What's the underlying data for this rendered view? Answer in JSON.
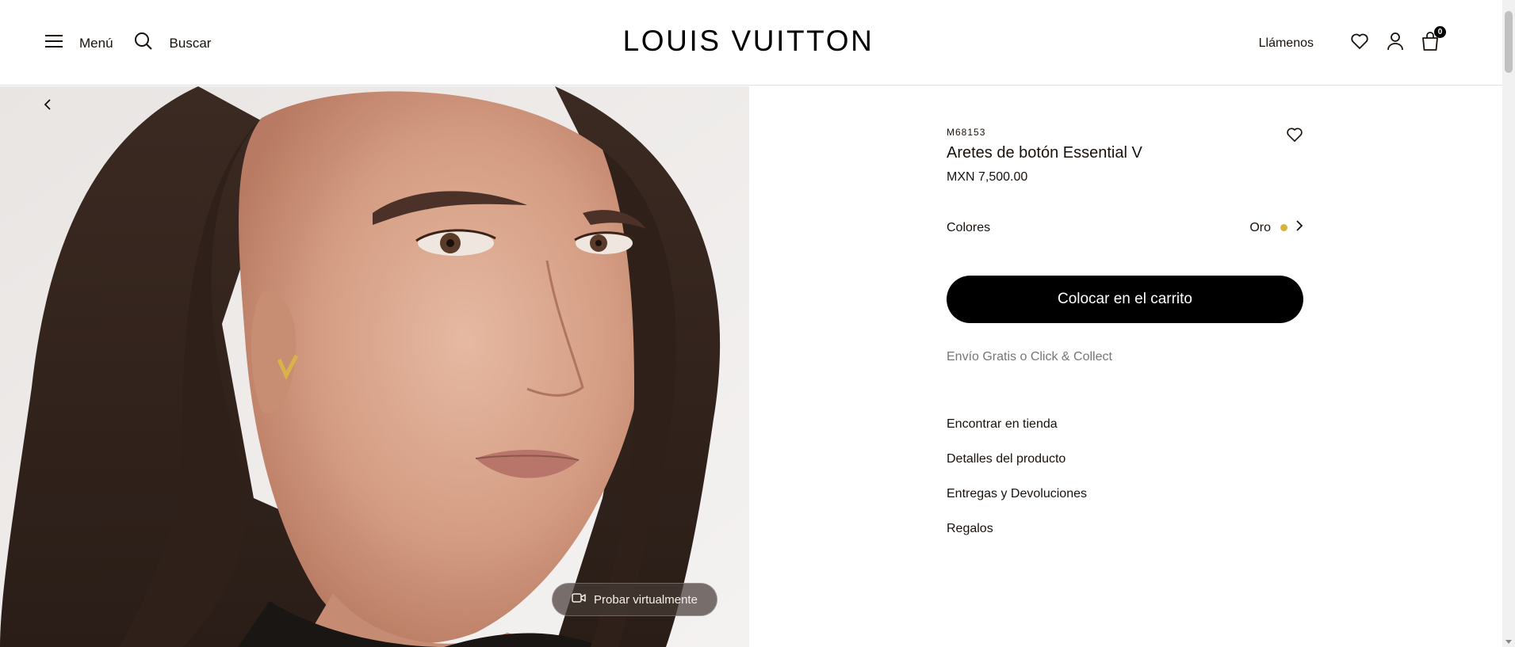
{
  "header": {
    "menu_label": "Menú",
    "search_label": "Buscar",
    "logo_text": "LOUIS VUITTON",
    "call_label": "Llámenos",
    "cart_count": "0",
    "icons": [
      "menu-icon",
      "search-icon",
      "heart-icon",
      "user-icon",
      "bag-icon"
    ]
  },
  "gallery": {
    "try_on_label": "Probar virtualmente",
    "icons": [
      "chevron-left-icon",
      "camera-icon"
    ]
  },
  "product": {
    "sku": "M68153",
    "name": "Aretes de botón Essential V",
    "price": "MXN 7,500.00",
    "colors_label": "Colores",
    "color_value": "Oro",
    "color_swatch": "#d8b33a",
    "add_to_cart_label": "Colocar en el carrito",
    "shipping_text": "Envío Gratis o Click & Collect",
    "links": [
      "Encontrar en tienda",
      "Detalles del producto",
      "Entregas y Devoluciones",
      "Regalos"
    ]
  },
  "colors": {
    "accent": "#000000",
    "text": "#19110b",
    "muted": "#767676",
    "swatch_gold": "#d8b33a"
  }
}
